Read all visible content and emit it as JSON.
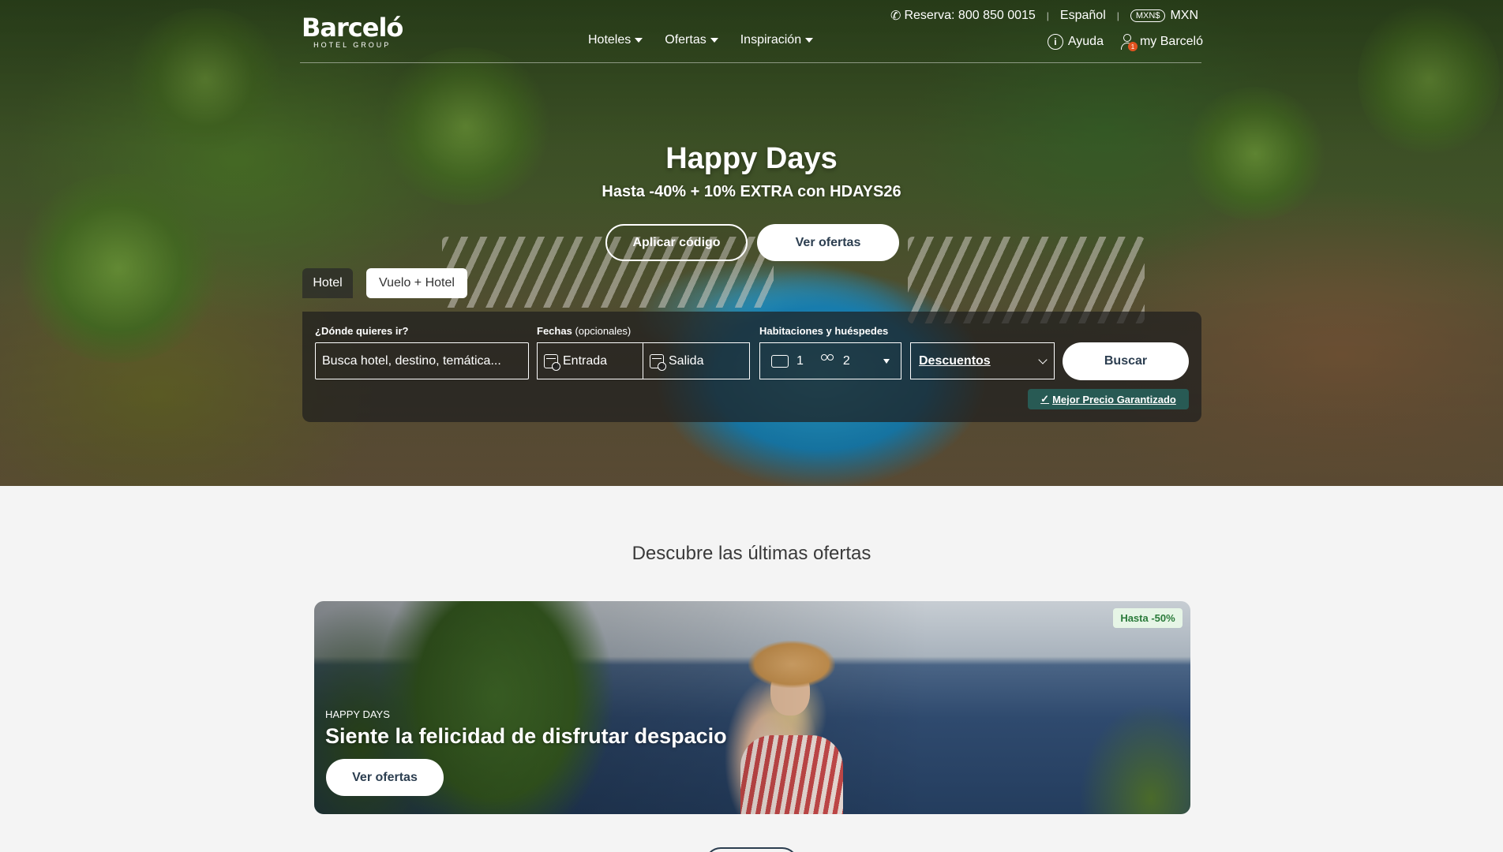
{
  "header": {
    "logo_brand": "Barceló",
    "logo_sub": "HOTEL GROUP",
    "phone_label": "Reserva: 800 850 0015",
    "language": "Español",
    "currency_chip": "MXN$",
    "currency": "MXN",
    "nav": [
      "Hoteles",
      "Ofertas",
      "Inspiración"
    ],
    "help": "Ayuda",
    "account": "my Barceló",
    "account_badge": "1"
  },
  "promo": {
    "title": "Happy Days",
    "subtitle": "Hasta -40% + 10% EXTRA con HDAYS26",
    "apply_code": "Aplicar código",
    "see_offers": "Ver ofertas"
  },
  "search": {
    "tabs": [
      "Hotel",
      "Vuelo + Hotel"
    ],
    "where_label": "¿Dónde quieres ir?",
    "where_placeholder": "Busca hotel, destino, temática...",
    "dates_label": "Fechas",
    "dates_optional": "(opcionales)",
    "checkin": "Entrada",
    "checkout": "Salida",
    "rooms_label": "Habitaciones y huéspedes",
    "rooms": "1",
    "guests": "2",
    "discounts": "Descuentos",
    "search_button": "Buscar",
    "best_price": "Mejor Precio Garantizado"
  },
  "offers": {
    "section_title": "Descubre las últimas ofertas",
    "card": {
      "badge": "Hasta -50%",
      "tag": "HAPPY DAYS",
      "heading": "Siente la felicidad de disfrutar despacio",
      "button": "Ver ofertas"
    }
  }
}
